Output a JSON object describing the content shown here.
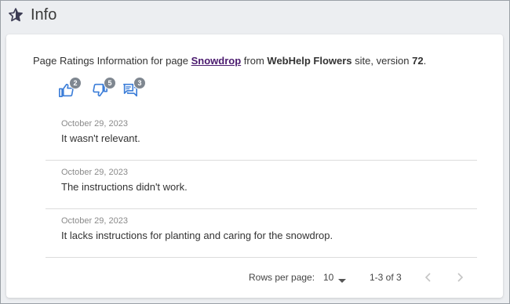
{
  "header": {
    "title": "Info",
    "icon": "star-icon"
  },
  "info": {
    "prefix": "Page Ratings Information for page ",
    "page_name": "Snowdrop",
    "middle": " from ",
    "site_name": "WebHelp Flowers",
    "suffix": " site, version ",
    "version": "72",
    "end": "."
  },
  "stats": {
    "likes": "2",
    "dislikes": "5",
    "comments": "3"
  },
  "comments": [
    {
      "date": "October 29, 2023",
      "text": "It wasn't relevant."
    },
    {
      "date": "October 29, 2023",
      "text": "The instructions didn't work."
    },
    {
      "date": "October 29, 2023",
      "text": "It lacks instructions for planting and caring for the snowdrop."
    }
  ],
  "pagination": {
    "rows_label": "Rows per page:",
    "rows_value": "10",
    "range": "1-3 of 3"
  },
  "colors": {
    "accent": "#3b7dd8",
    "link": "#4a1a6e",
    "badge": "#7f8790"
  }
}
